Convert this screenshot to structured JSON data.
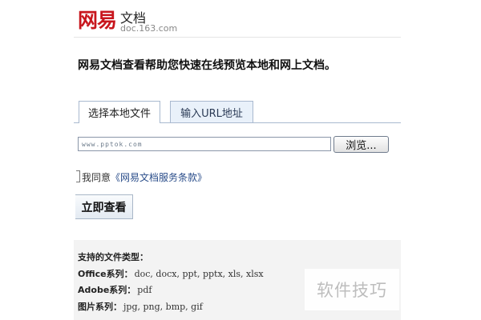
{
  "header": {
    "logo_mark": "网易",
    "title": "文档",
    "domain": "doc.163.com"
  },
  "intro": "网易文档查看帮助您快速在线预览本地和网上文档。",
  "tabs": [
    {
      "label": "选择本地文件",
      "active": true
    },
    {
      "label": "输入URL地址",
      "active": false
    }
  ],
  "file_input": {
    "value": "www.pptok.com"
  },
  "browse_label": "浏览...",
  "agree": {
    "prefix": "我同意",
    "link": "《网易文档服务条款》"
  },
  "view_button": "立即查看",
  "supported": {
    "heading": "支持的文件类型：",
    "rows": [
      {
        "category": "Office系列：",
        "exts": "doc, docx, ppt, pptx, xls, xlsx"
      },
      {
        "category": "Adobe系列：",
        "exts": "pdf"
      },
      {
        "category": "图片系列：",
        "exts": "jpg, png, bmp, gif"
      }
    ]
  },
  "watermark": "软件技巧",
  "colors": {
    "brand_red": "#c8161d",
    "tab_border": "#a9b9cf",
    "link": "#2a4d8a"
  }
}
